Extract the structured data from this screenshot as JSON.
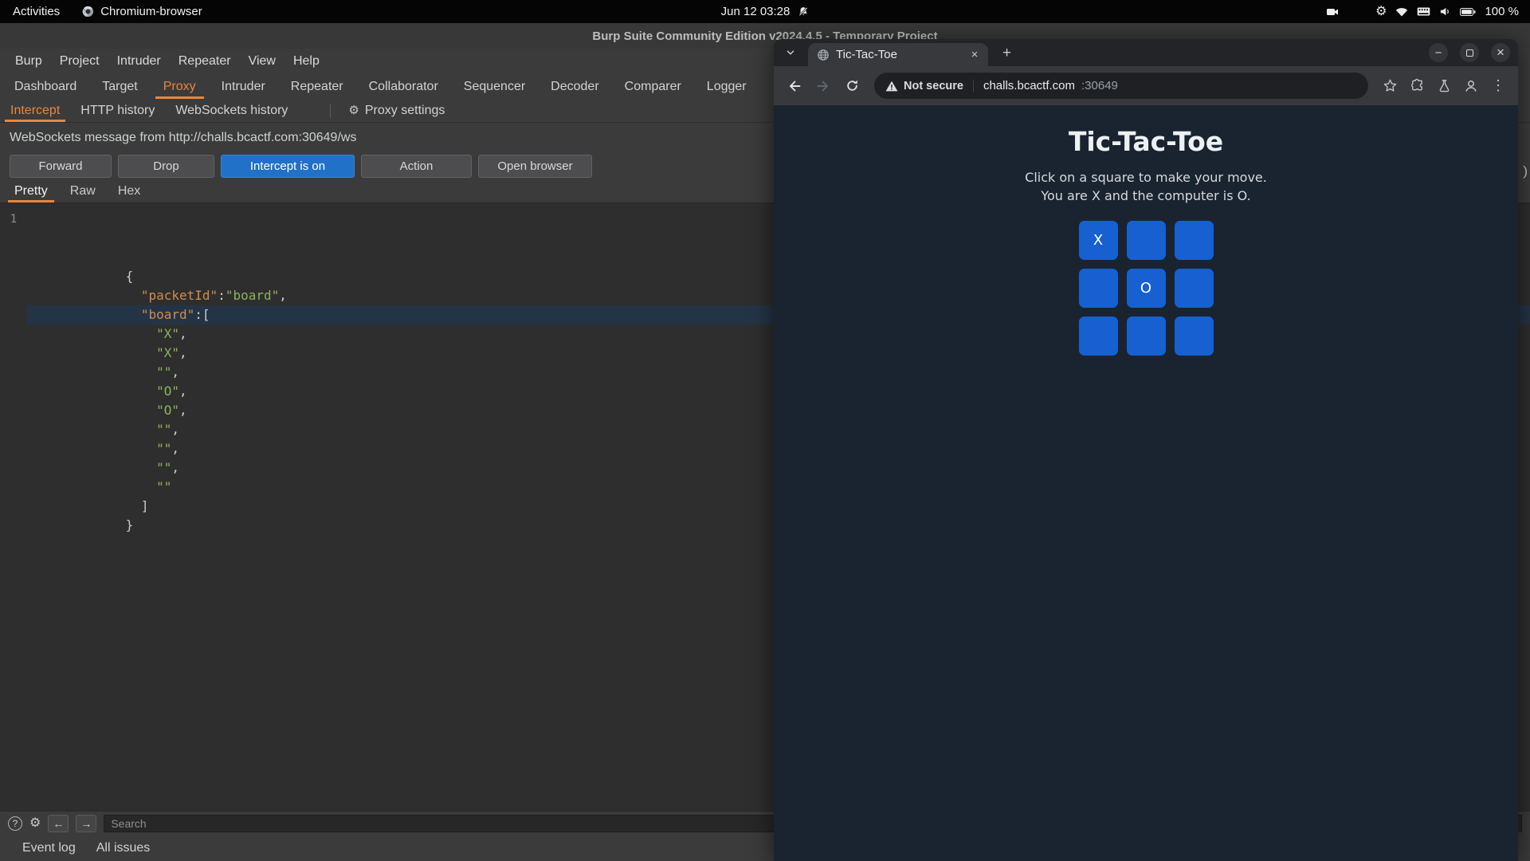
{
  "colors": {
    "burp_accent": "#e8873c",
    "intercept_bg": "#2171c8",
    "cell_bg": "#1660d2",
    "json_key": "#d08c4a",
    "json_str": "#8cb35c",
    "page_bg": "#1a2430"
  },
  "icons": {
    "gear": "⚙",
    "help": "?",
    "prev_arrow": "←",
    "next_arrow": "→",
    "close_x": "×",
    "new_tab_plus": "+",
    "minimize": "−",
    "kebab_menu": "⋮"
  },
  "topbar": {
    "activities": "Activities",
    "app": "Chromium-browser",
    "clock": "Jun 12 03:28",
    "battery": "100 %"
  },
  "burp": {
    "title": "Burp Suite Community Edition v2024.4.5 - Temporary Project",
    "menu": [
      "Burp",
      "Project",
      "Intruder",
      "Repeater",
      "View",
      "Help"
    ],
    "tabs": [
      {
        "label": "Dashboard",
        "active": false
      },
      {
        "label": "Target",
        "active": false
      },
      {
        "label": "Proxy",
        "active": true
      },
      {
        "label": "Intruder",
        "active": false
      },
      {
        "label": "Repeater",
        "active": false
      },
      {
        "label": "Collaborator",
        "active": false
      },
      {
        "label": "Sequencer",
        "active": false
      },
      {
        "label": "Decoder",
        "active": false
      },
      {
        "label": "Comparer",
        "active": false
      },
      {
        "label": "Logger",
        "active": false
      }
    ],
    "subtabs": [
      {
        "label": "Intercept",
        "active": true
      },
      {
        "label": "HTTP history",
        "active": false
      },
      {
        "label": "WebSockets history",
        "active": false
      }
    ],
    "proxy_settings": "Proxy settings",
    "message": "WebSockets message from http://challs.bcactf.com:30649/ws",
    "actions": {
      "forward": "Forward",
      "drop": "Drop",
      "intercept": "Intercept is on",
      "action": "Action",
      "open_browser": "Open browser"
    },
    "view_tabs": [
      {
        "label": "Pretty",
        "active": true
      },
      {
        "label": "Raw",
        "active": false
      },
      {
        "label": "Hex",
        "active": false
      }
    ],
    "editor": {
      "line_number": "1",
      "lines": [
        {
          "hl": false,
          "tokens": [
            {
              "c": "pun",
              "t": "{"
            }
          ]
        },
        {
          "hl": false,
          "tokens": [
            {
              "c": "pun",
              "t": "  "
            },
            {
              "c": "key",
              "t": "\"packetId\""
            },
            {
              "c": "pun",
              "t": ":"
            },
            {
              "c": "str",
              "t": "\"board\""
            },
            {
              "c": "pun",
              "t": ","
            }
          ]
        },
        {
          "hl": false,
          "tokens": [
            {
              "c": "pun",
              "t": "  "
            },
            {
              "c": "key",
              "t": "\"board\""
            },
            {
              "c": "pun",
              "t": ":["
            }
          ]
        },
        {
          "hl": false,
          "tokens": [
            {
              "c": "pun",
              "t": "    "
            },
            {
              "c": "str",
              "t": "\"X\""
            },
            {
              "c": "pun",
              "t": ","
            }
          ]
        },
        {
          "hl": false,
          "tokens": [
            {
              "c": "pun",
              "t": "    "
            },
            {
              "c": "str",
              "t": "\"X\""
            },
            {
              "c": "pun",
              "t": ","
            }
          ]
        },
        {
          "hl": true,
          "tokens": [
            {
              "c": "pun",
              "t": "    "
            },
            {
              "c": "str",
              "t": "\"\""
            },
            {
              "c": "pun",
              "t": ","
            }
          ]
        },
        {
          "hl": false,
          "tokens": [
            {
              "c": "pun",
              "t": "    "
            },
            {
              "c": "str",
              "t": "\"O\""
            },
            {
              "c": "pun",
              "t": ","
            }
          ]
        },
        {
          "hl": false,
          "tokens": [
            {
              "c": "pun",
              "t": "    "
            },
            {
              "c": "str",
              "t": "\"O\""
            },
            {
              "c": "pun",
              "t": ","
            }
          ]
        },
        {
          "hl": false,
          "tokens": [
            {
              "c": "pun",
              "t": "    "
            },
            {
              "c": "str",
              "t": "\"\""
            },
            {
              "c": "pun",
              "t": ","
            }
          ]
        },
        {
          "hl": false,
          "tokens": [
            {
              "c": "pun",
              "t": "    "
            },
            {
              "c": "str",
              "t": "\"\""
            },
            {
              "c": "pun",
              "t": ","
            }
          ]
        },
        {
          "hl": false,
          "tokens": [
            {
              "c": "pun",
              "t": "    "
            },
            {
              "c": "str",
              "t": "\"\""
            },
            {
              "c": "pun",
              "t": ","
            }
          ]
        },
        {
          "hl": false,
          "tokens": [
            {
              "c": "pun",
              "t": "    "
            },
            {
              "c": "str",
              "t": "\"\""
            }
          ]
        },
        {
          "hl": false,
          "tokens": [
            {
              "c": "pun",
              "t": "  ]"
            }
          ]
        },
        {
          "hl": false,
          "tokens": [
            {
              "c": "pun",
              "t": "}"
            }
          ]
        }
      ]
    },
    "search_placeholder": "Search",
    "status": {
      "event_log": "Event log",
      "all_issues": "All issues"
    },
    "sliver": ")"
  },
  "chrome": {
    "tab": {
      "title": "Tic-Tac-Toe"
    },
    "security": "Not secure",
    "url": {
      "host": "challs.bcactf.com",
      "port": ":30649"
    },
    "page": {
      "title": "Tic-Tac-Toe",
      "line1": "Click on a square to make your move.",
      "line2": "You are X and the computer is O.",
      "board": [
        "X",
        "",
        "",
        "",
        "O",
        "",
        "",
        "",
        ""
      ]
    }
  }
}
